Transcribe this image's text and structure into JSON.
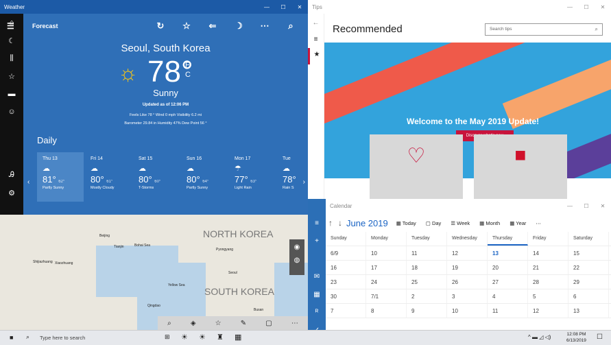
{
  "weather": {
    "title": "Weather",
    "header": "Forecast",
    "city": "Seoul, South Korea",
    "temp": "78",
    "deg": "°",
    "unit_f": "F",
    "unit_c": "C",
    "condition": "Sunny",
    "updated": "Updated as of 12:06 PM",
    "stats1": "Feels Like  78 °     Wind  0 mph     Visibility  6.2 mi",
    "stats2": "Barometer  29.84 in     Humidity  47%     Dew Point  56 °",
    "daily": "Daily",
    "days": [
      {
        "d": "Thu 13",
        "h": "81°",
        "l": "62°",
        "s": "Partly Sunny"
      },
      {
        "d": "Fri 14",
        "h": "80°",
        "l": "61°",
        "s": "Mostly Cloudy"
      },
      {
        "d": "Sat 15",
        "h": "80°",
        "l": "60°",
        "s": "T-Storms"
      },
      {
        "d": "Sun 16",
        "h": "80°",
        "l": "64°",
        "s": "Partly Sunny"
      },
      {
        "d": "Mon 17",
        "h": "77°",
        "l": "63°",
        "s": "Light Rain"
      },
      {
        "d": "Tue",
        "h": "78°",
        "l": "",
        "s": "Rain S"
      }
    ]
  },
  "map": {
    "north": "NORTH KOREA",
    "south": "SOUTH KOREA",
    "places": [
      "Beijing",
      "Tianjin",
      "Bohai Sea",
      "Pyongyang",
      "Seoul",
      "Yellow Sea",
      "Qingdao",
      "Busan",
      "Shijiazhuang",
      "Xiaozhuang"
    ]
  },
  "tips": {
    "title": "Tips",
    "heading": "Recommended",
    "search": "Search tips",
    "welcome": "Welcome to the May 2019 Update!",
    "button": "Discover what's new"
  },
  "calendar": {
    "title": "Calendar",
    "month": "June 2019",
    "views": [
      "Today",
      "Day",
      "Week",
      "Month",
      "Year"
    ],
    "headers": [
      "Sunday",
      "Monday",
      "Tuesday",
      "Wednesday",
      "Thursday",
      "Friday",
      "Saturday"
    ],
    "weeks": [
      [
        "6/9",
        "10",
        "11",
        "12",
        "13",
        "14",
        "15"
      ],
      [
        "16",
        "17",
        "18",
        "19",
        "20",
        "21",
        "22"
      ],
      [
        "23",
        "24",
        "25",
        "26",
        "27",
        "28",
        "29"
      ],
      [
        "30",
        "7/1",
        "2",
        "3",
        "4",
        "5",
        "6"
      ],
      [
        "7",
        "8",
        "9",
        "10",
        "11",
        "12",
        "13"
      ]
    ]
  },
  "taskbar": {
    "search": "Type here to search",
    "time": "12:08 PM",
    "date": "6/13/2019"
  }
}
